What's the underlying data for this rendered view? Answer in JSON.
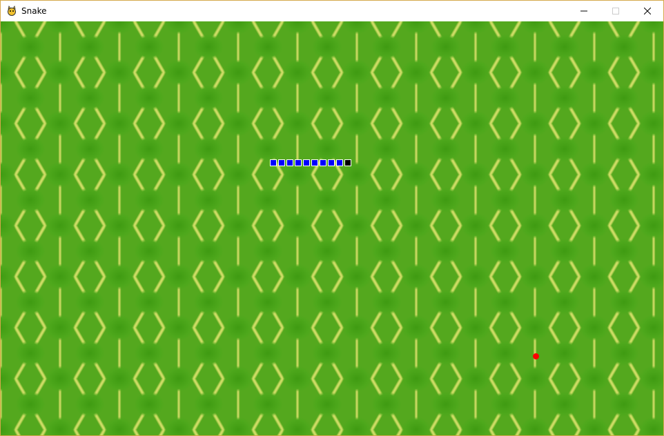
{
  "window": {
    "title": "Snake",
    "app_icon": "pygame-snake-icon",
    "controls": {
      "minimize": "minimize-icon",
      "maximize": "maximize-icon",
      "close": "close-icon"
    }
  },
  "game": {
    "background": "green-lizard-skin-texture",
    "snake": {
      "length": 10,
      "direction": "right",
      "body_color": "#0000ff",
      "head_color": "#000000",
      "outline_color": "#ffffff"
    },
    "food": {
      "color": "#ff0000"
    }
  }
}
